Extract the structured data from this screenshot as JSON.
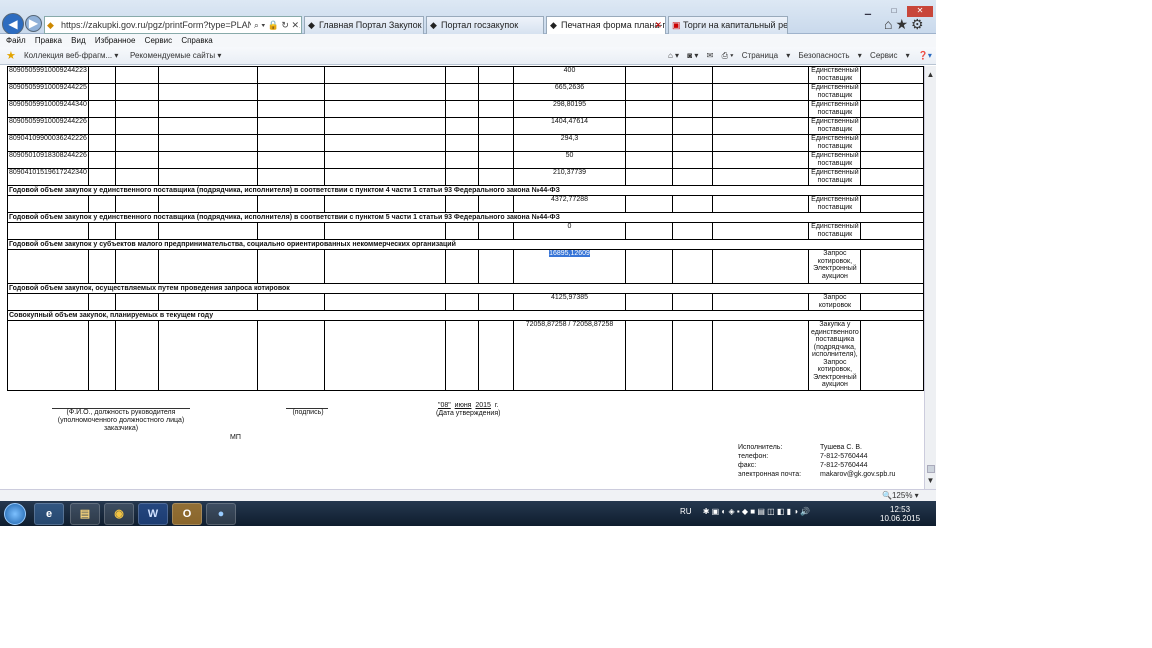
{
  "browser": {
    "url": "https://zakupki.gov.ru/pgz/printForm?type=PLAN_GRAPHIK",
    "tabs": [
      {
        "label": "Главная Портал Закупок",
        "active": false
      },
      {
        "label": "Портал госзакупок",
        "active": false
      },
      {
        "label": "Печатная форма плана-гр...",
        "active": true
      },
      {
        "label": "Торги на капитальный ремо...",
        "active": false
      }
    ],
    "menu": [
      "Файл",
      "Правка",
      "Вид",
      "Избранное",
      "Сервис",
      "Справка"
    ],
    "favorites": {
      "fav1": "Коллекция веб-фрагм...",
      "fav2": "Рекомендуемые сайты"
    },
    "commands": [
      "Страница",
      "Безопасность",
      "Сервис"
    ],
    "zoom": "125%"
  },
  "table": {
    "rows": [
      {
        "code": "80905059910009244223",
        "sum": "400",
        "way": "Единственный поставщик"
      },
      {
        "code": "80905059910009244225",
        "sum": "665,2636",
        "way": "Единственный поставщик"
      },
      {
        "code": "80905059910009244340",
        "sum": "298,80195",
        "way": "Единственный поставщик"
      },
      {
        "code": "80905059910009244226",
        "sum": "1404,47614",
        "way": "Единственный поставщик"
      },
      {
        "code": "80904109900036242226",
        "sum": "294,3",
        "way": "Единственный поставщик"
      },
      {
        "code": "80905010918308244226",
        "sum": "50",
        "way": "Единственный поставщик"
      },
      {
        "code": "80904101519617242340",
        "sum": "210,37739",
        "way": "Единственный поставщик"
      }
    ],
    "sections": [
      {
        "title": "Годовой объем закупок у единственного поставщика (подрядчика, исполнителя) в соответствии с пунктом 4 части 1 статьи 93 Федерального закона №44-ФЗ",
        "sum": "4372,77288",
        "way": "Единственный поставщик"
      },
      {
        "title": "Годовой объем закупок у единственного поставщика (подрядчика, исполнителя) в соответствии с пунктом 5 части 1 статьи 93 Федерального закона №44-ФЗ",
        "sum": "0",
        "way": "Единственный поставщик"
      },
      {
        "title": "Годовой объем закупок у субъектов малого предпринимательства, социально ориентированных некоммерческих организаций",
        "sum": "16895,12609",
        "way": "Запрос котировок, Электронный аукцион"
      },
      {
        "title": "Годовой объем закупок, осуществляемых путем проведения запроса котировок",
        "sum": "4125,97385",
        "way": "Запрос котировок"
      },
      {
        "title": "Совокупный объем закупок, планируемых в текущем году",
        "sum": "72058,87258 / 72058,87258",
        "way": "Закупка у единственного поставщика (подрядчика, исполнителя), Запрос котировок, Электронный аукцион"
      }
    ]
  },
  "signature": {
    "head_caption": "(Ф.И.О., должность руководителя (уполномоченного должностного лица) заказчика)",
    "sign_caption": "(подпись)",
    "date_day": "\"08\"",
    "date_month": "июня",
    "date_year": "2015",
    "date_suffix": "г.",
    "date_caption": "(Дата утверждения)",
    "mp": "МП",
    "executor_label": "Исполнитель:",
    "executor": "Тушева С. В.",
    "phone_label": "телефон:",
    "phone": "7-812-5760444",
    "fax_label": "факс:",
    "fax": "7-812-5760444",
    "email_label": "электронная почта:",
    "email": "makarov@gk.gov.spb.ru"
  },
  "taskbar": {
    "lang": "RU",
    "time": "12:53",
    "date": "10.06.2015"
  }
}
